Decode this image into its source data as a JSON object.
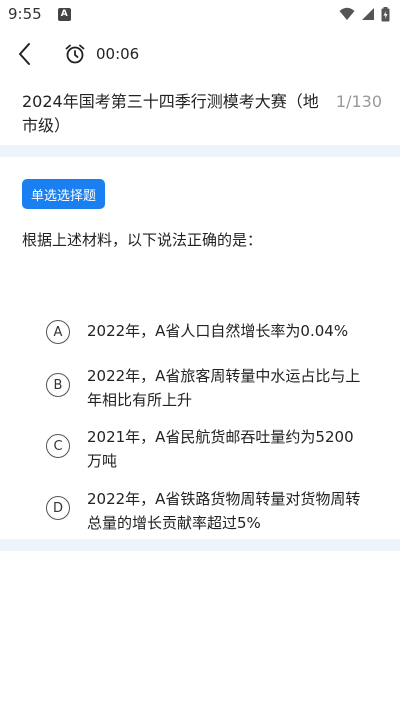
{
  "status_bar": {
    "time": "9:55",
    "notification_icon": "A"
  },
  "nav": {
    "back_icon": "chevron-left-icon",
    "alarm_icon": "alarm-clock-icon",
    "timer": "00:06"
  },
  "question": {
    "title": "2024年国考第三十四季行测模考大赛（地市级）",
    "counter": "1/130",
    "type_tag": "单选选择题",
    "stem": "根据上述材料，以下说法正确的是：",
    "options": [
      {
        "letter": "A",
        "text": "2022年，A省人口自然增长率为0.04%"
      },
      {
        "letter": "B",
        "text": "2022年，A省旅客周转量中水运占比与上年相比有所上升"
      },
      {
        "letter": "C",
        "text": "2021年，A省民航货邮吞吐量约为5200万吨"
      },
      {
        "letter": "D",
        "text": "2022年，A省铁路货物周转量对货物周转总量的增长贡献率超过5%"
      }
    ]
  },
  "colors": {
    "accent": "#1a7ff0",
    "band": "#edf3fb",
    "counter": "#999999"
  }
}
